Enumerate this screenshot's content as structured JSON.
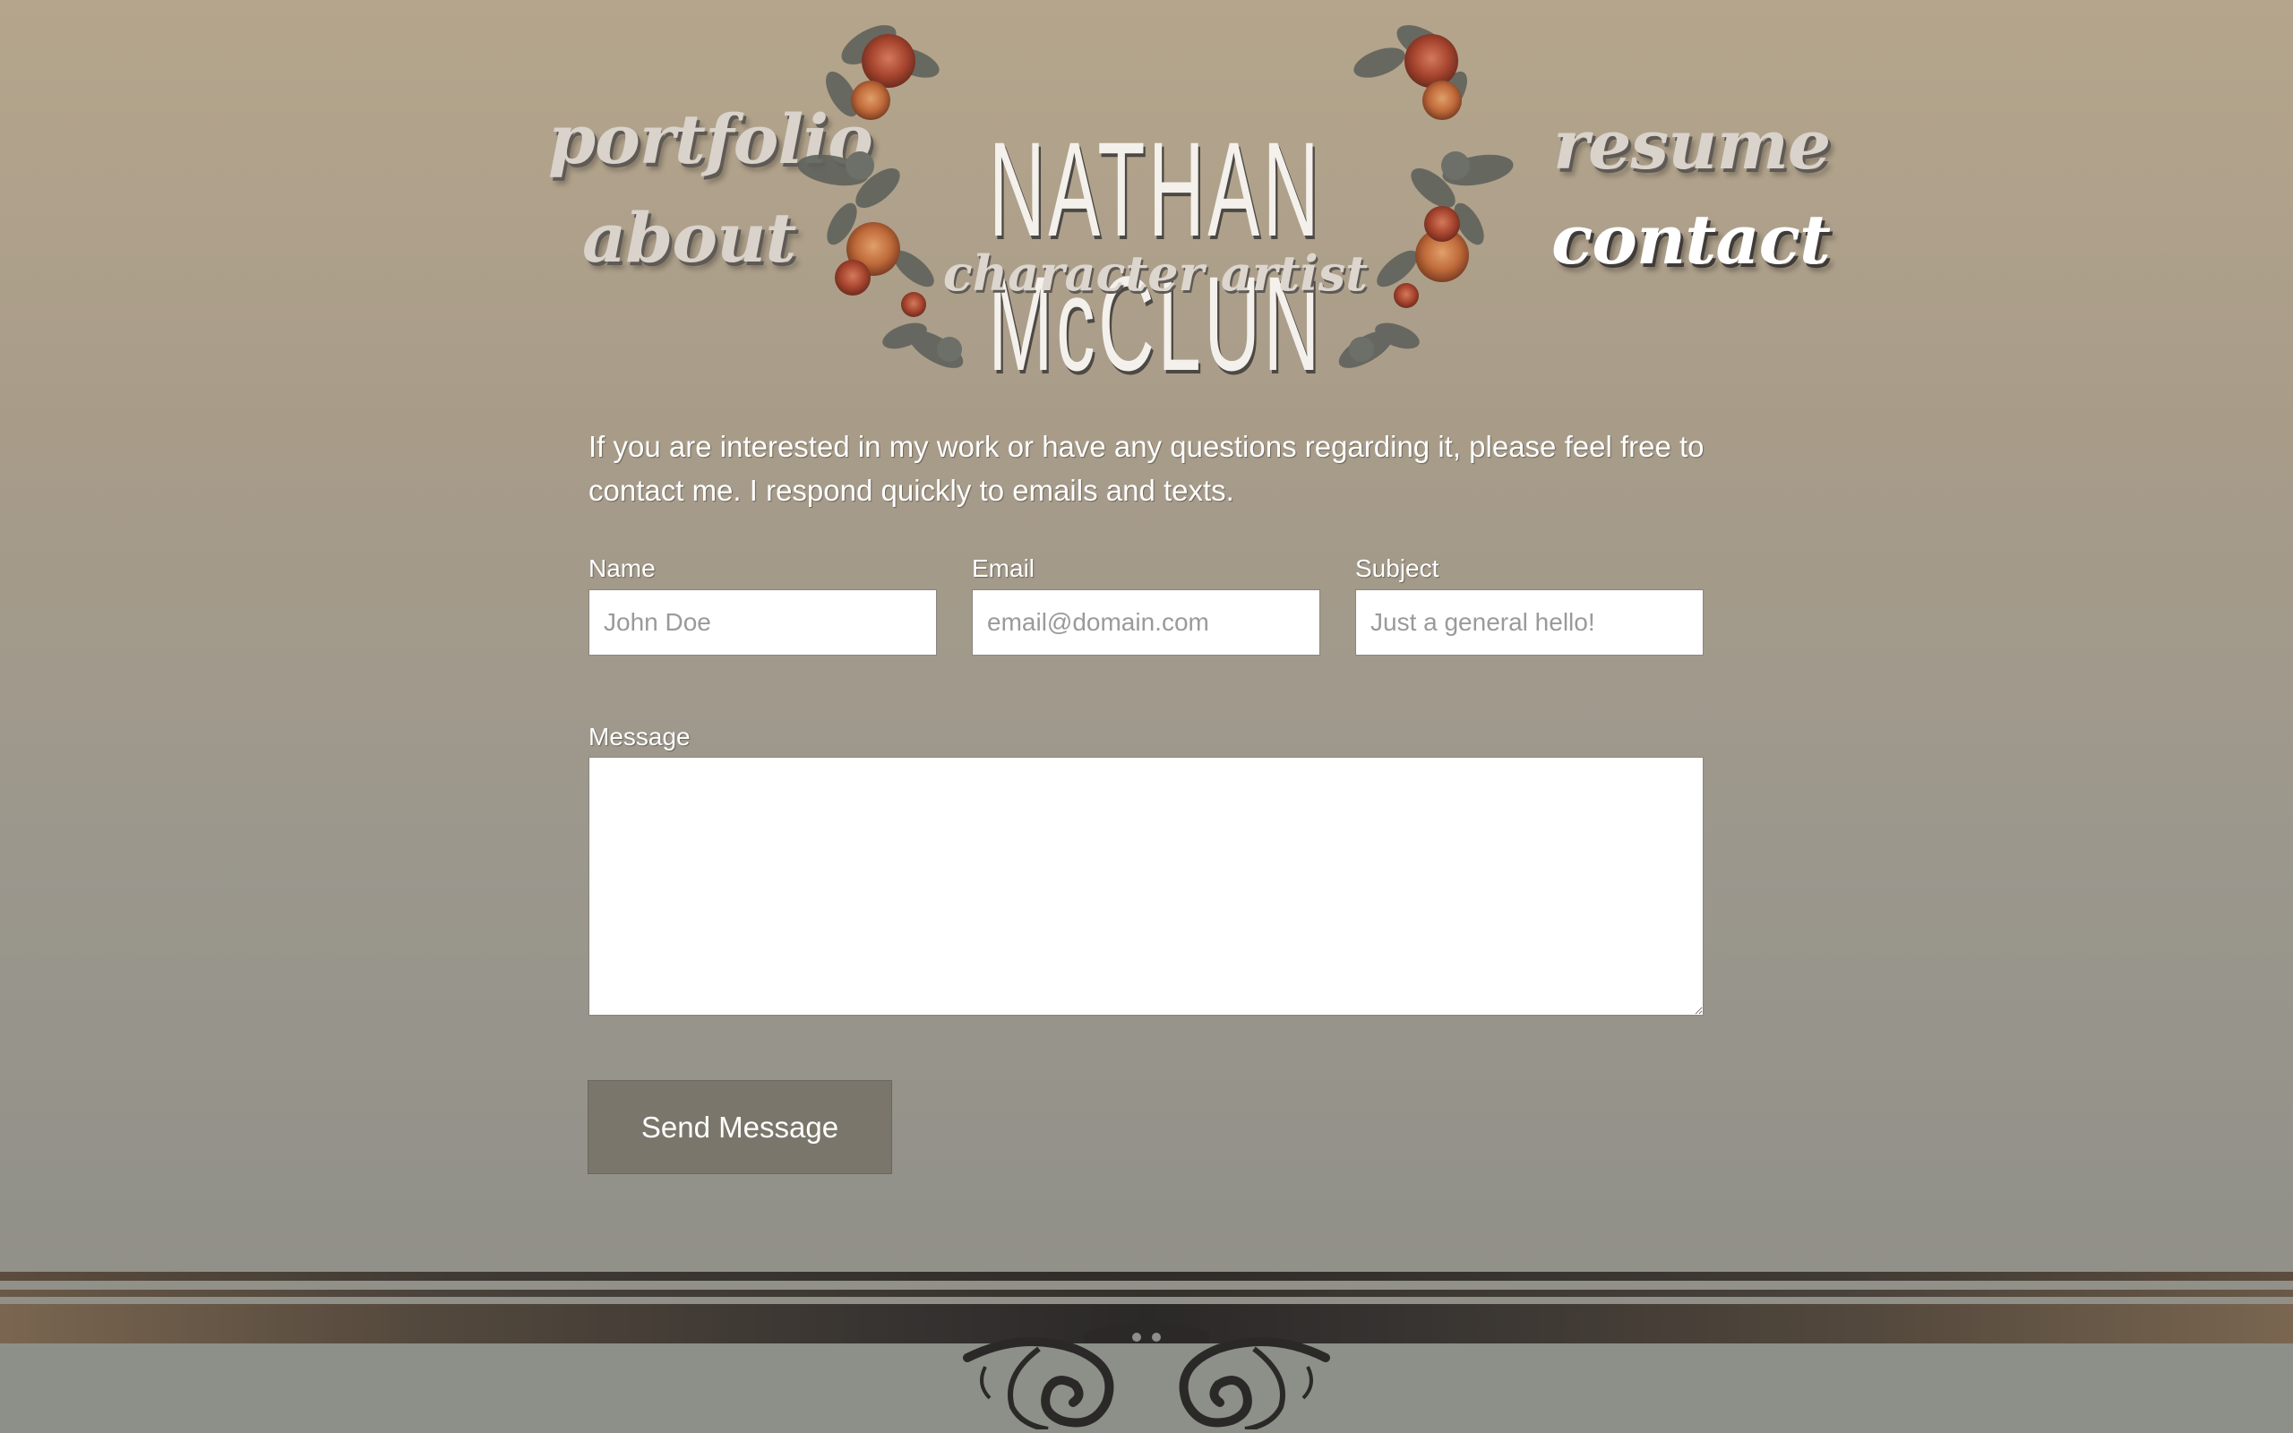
{
  "nav": {
    "portfolio": "portfolio",
    "about": "about",
    "resume": "resume",
    "contact": "contact",
    "active": "contact"
  },
  "logo": {
    "name": "NATHAN McCLUN",
    "subtitle": "character artist"
  },
  "intro": "If you are interested in my work or have any questions regarding it, please feel free to contact me. I respond quickly to emails and texts.",
  "form": {
    "name_label": "Name",
    "name_placeholder": "John Doe",
    "email_label": "Email",
    "email_placeholder": "email@domain.com",
    "subject_label": "Subject",
    "subject_placeholder": "Just a general hello!",
    "message_label": "Message",
    "message_value": "",
    "submit_label": "Send Message"
  },
  "colors": {
    "background_top": "#b5a58c",
    "background_bottom": "#8e8e88",
    "button": "#7a766b",
    "footer_dark": "#2b2927",
    "rose": "#b5503a"
  }
}
